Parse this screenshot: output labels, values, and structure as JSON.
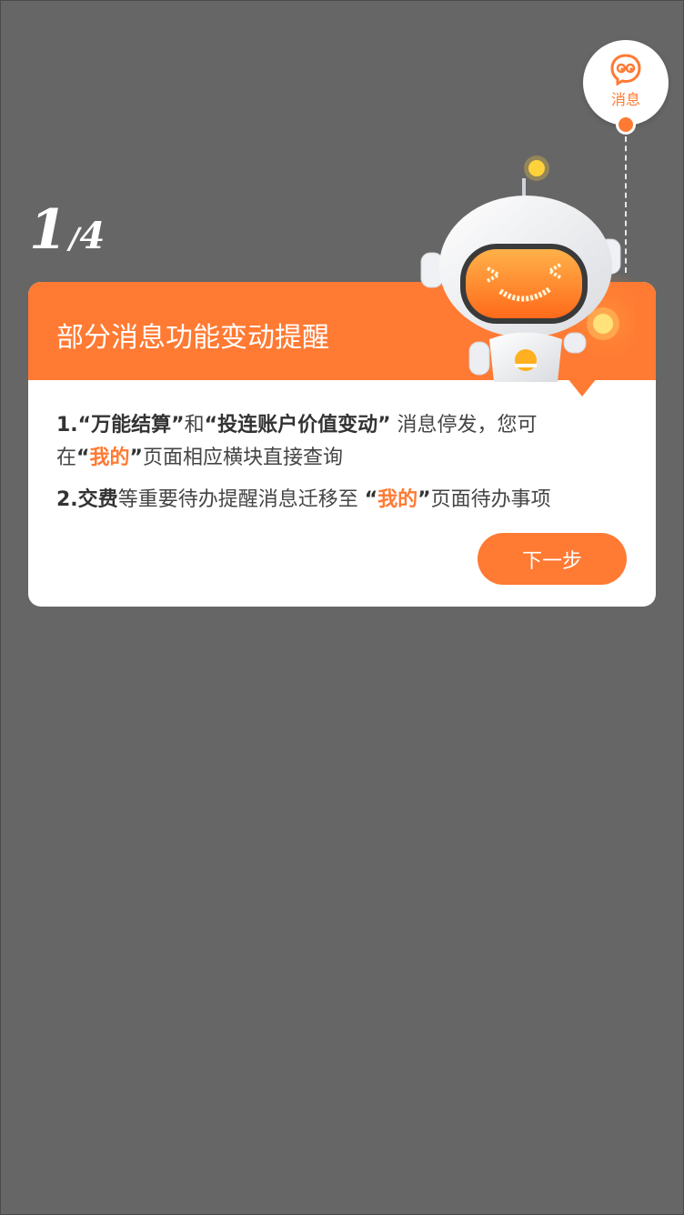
{
  "step": {
    "current": "1",
    "separator": "/",
    "total": "4"
  },
  "message_button": {
    "label": "消息"
  },
  "card": {
    "title": "部分消息功能变动提醒",
    "item1": {
      "num": "1.",
      "q1": "“万能结算”",
      "mid": "和",
      "q2": "“投连账户价值变动”",
      "tail": " 消息停发，您可",
      "line2_pre": "在",
      "lq": "“",
      "mine": "我的",
      "rq": "”",
      "line2_post": "页面相应横块直接查询"
    },
    "item2": {
      "num": "2.",
      "b": "交费",
      "mid": "等重要待办提醒消息迁移至 ",
      "lq": "“",
      "mine": "我的",
      "rq": "”",
      "tail": "页面待办事项"
    },
    "next_label": "下一步"
  },
  "colors": {
    "accent": "#ff7a33",
    "overlay": "#666666",
    "card": "#ffffff"
  },
  "icons": {
    "message": "chat-bubble-icon",
    "mascot": "robot-mascot"
  }
}
